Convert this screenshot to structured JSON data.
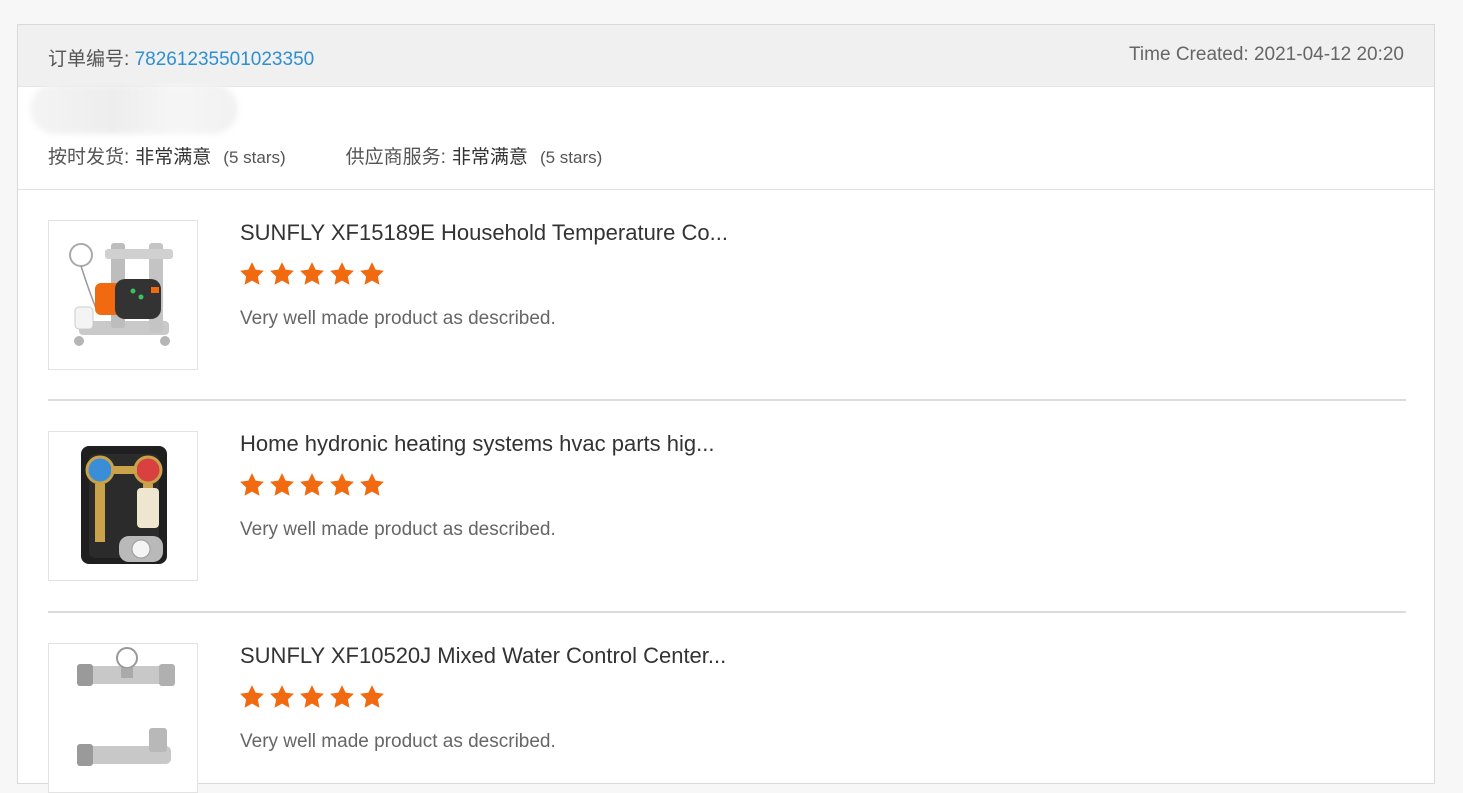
{
  "order": {
    "label": "订单编号: ",
    "number": "78261235501023350",
    "time_created": "Time Created: 2021-04-12 20:20"
  },
  "ratings": [
    {
      "label": "按时发货:",
      "value": "非常满意",
      "stars_text": "(5 stars)"
    },
    {
      "label": "供应商服务:",
      "value": "非常满意",
      "stars_text": "(5 stars)"
    }
  ],
  "colors": {
    "accent_link": "#2f8fd0",
    "star": "#f26a10"
  },
  "items": [
    {
      "title": "SUNFLY XF15189E Household Temperature Co...",
      "rating": 5,
      "comment": "Very well made product as described.",
      "thumb_icon": "pump-valve-assembly-icon"
    },
    {
      "title": "Home hydronic heating systems hvac parts hig...",
      "rating": 5,
      "comment": "Very well made product as described.",
      "thumb_icon": "heating-pump-station-icon"
    },
    {
      "title": "SUNFLY XF10520J Mixed Water Control Center...",
      "rating": 5,
      "comment": "Very well made product as described.",
      "thumb_icon": "mixing-valve-icon"
    }
  ]
}
